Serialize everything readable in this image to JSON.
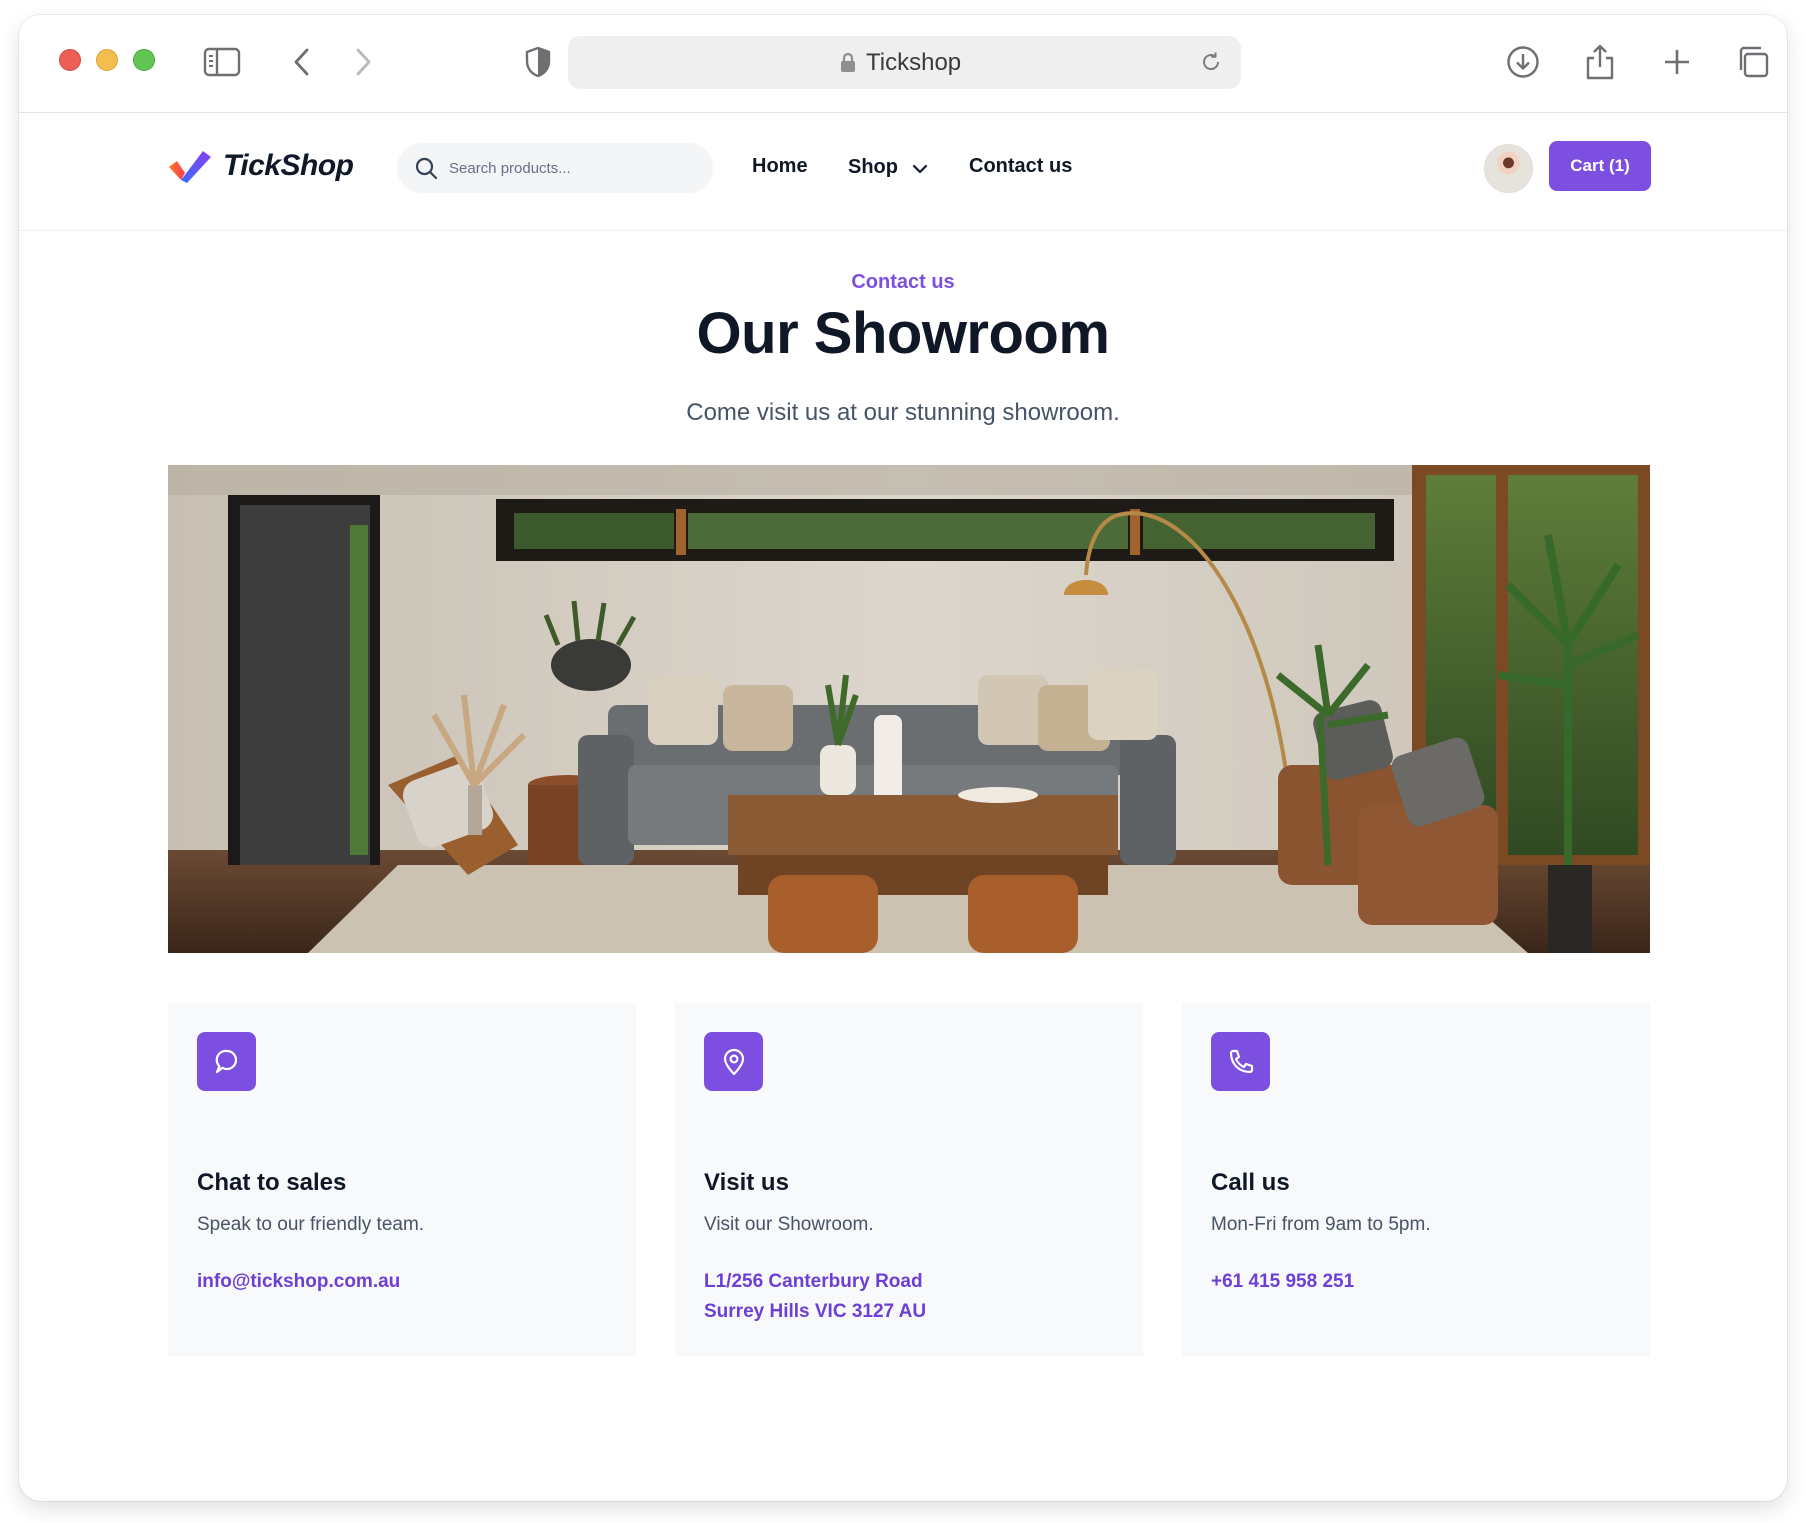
{
  "browser": {
    "url_title": "Tickshop"
  },
  "header": {
    "logo_text": "TickShop",
    "search_placeholder": "Search products...",
    "nav": {
      "home": "Home",
      "shop": "Shop",
      "contact": "Contact us"
    },
    "cart_label": "Cart (1)"
  },
  "hero": {
    "eyebrow": "Contact us",
    "title": "Our Showroom",
    "subtitle": "Come visit us at our stunning showroom."
  },
  "cards": [
    {
      "icon": "chat-bubble-icon",
      "title": "Chat to sales",
      "description": "Speak to our friendly team.",
      "link_lines": [
        "info@tickshop.com.au"
      ]
    },
    {
      "icon": "map-pin-icon",
      "title": "Visit us",
      "description": "Visit our Showroom.",
      "link_lines": [
        "L1/256 Canterbury Road",
        "Surrey Hills VIC 3127 AU"
      ]
    },
    {
      "icon": "phone-icon",
      "title": "Call us",
      "description": "Mon-Fri from 9am to 5pm.",
      "link_lines": [
        "+61 415 958 251"
      ]
    }
  ],
  "colors": {
    "accent": "#7c4fe0",
    "heading": "#101828",
    "body_text": "#475467",
    "card_bg": "#f8f9fa"
  }
}
